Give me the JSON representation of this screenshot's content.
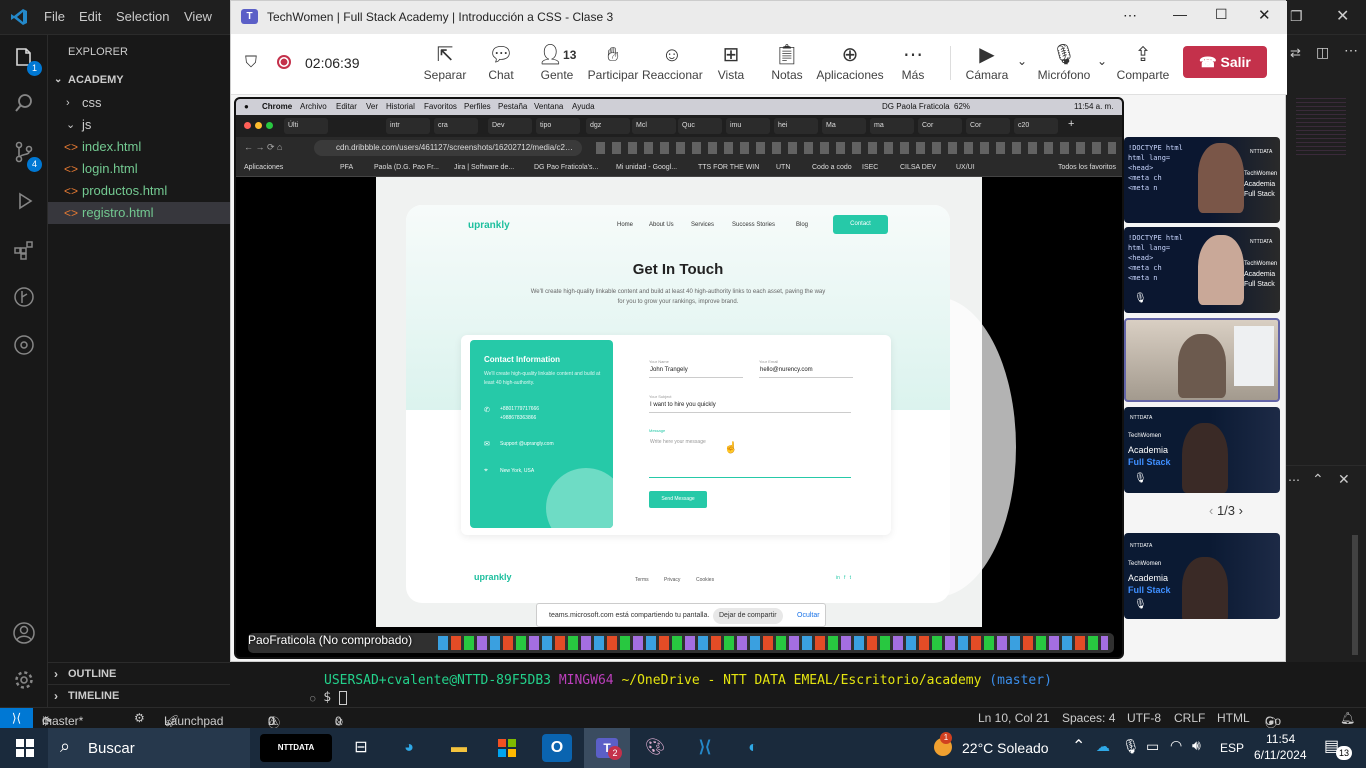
{
  "vscode": {
    "menu": [
      "File",
      "Edit",
      "Selection",
      "View"
    ],
    "explorer_title": "EXPLORER",
    "project": "ACADEMY",
    "tree": [
      {
        "name": "css",
        "type": "folder",
        "open": false
      },
      {
        "name": "js",
        "type": "folder",
        "open": true
      },
      {
        "name": "index.html",
        "type": "file"
      },
      {
        "name": "login.html",
        "type": "file"
      },
      {
        "name": "productos.html",
        "type": "file"
      },
      {
        "name": "registro.html",
        "type": "file",
        "selected": true
      }
    ],
    "outline": "OUTLINE",
    "timeline": "TIMELINE",
    "badges": {
      "explorer": "1",
      "scm": "4"
    },
    "terminal": {
      "user": "USERSAD+cvalente@NTTD-89F5DB3",
      "shell": "MINGW64",
      "path": "~/OneDrive - NTT DATA EMEAL/Escritorio/academy",
      "branch": "(master)",
      "prompt": "$"
    },
    "status": {
      "branch": "master*",
      "launchpad": "Launchpad",
      "errors": "0",
      "warnings": "0",
      "ports": "0",
      "position": "Ln 10, Col 21",
      "spaces": "Spaces: 4",
      "encoding": "UTF-8",
      "eol": "CRLF",
      "language": "HTML",
      "golive": "Go Live"
    }
  },
  "teams": {
    "title": "TechWomen | Full Stack Academy | Introducción a CSS - Clase 3",
    "timer": "02:06:39",
    "controls": [
      {
        "label": "Separar",
        "icon": "popout-icon"
      },
      {
        "label": "Chat",
        "icon": "chat-icon"
      },
      {
        "label": "Gente",
        "icon": "people-icon",
        "count": "13"
      },
      {
        "label": "Participar",
        "icon": "raise-hand-icon"
      },
      {
        "label": "Reaccionar",
        "icon": "smile-icon"
      },
      {
        "label": "Vista",
        "icon": "grid-icon"
      },
      {
        "label": "Notas",
        "icon": "notes-icon"
      },
      {
        "label": "Aplicaciones",
        "icon": "plus-icon"
      },
      {
        "label": "Más",
        "icon": "more-icon"
      }
    ],
    "camera": "Cámara",
    "mic": "Micrófono",
    "share": "Comparte",
    "leave": "Salir",
    "presenter": "PaoFraticola (No comprobado)",
    "pagination": "1/3",
    "tile_texts": {
      "t1": [
        "TechWomen",
        "Academia",
        "Full Stack"
      ],
      "brand": "NTTDATA"
    }
  },
  "shared": {
    "mac_menu": [
      "Chrome",
      "Archivo",
      "Editar",
      "Ver",
      "Historial",
      "Favoritos",
      "Perfiles",
      "Pestaña",
      "Ventana",
      "Ayuda"
    ],
    "mac_status": [
      "DG Paola Fraticola",
      "62%",
      "11:54 a. m."
    ],
    "url": "cdn.dribbble.com/users/461127/screenshots/16202712/media/c2…",
    "tabs": [
      "Últi",
      "",
      "intr",
      "cra",
      "Dev",
      "tipo",
      "dgz",
      "Mcl",
      "Quc",
      "imu",
      "hei",
      "Ma",
      "ma",
      "Cor",
      "Cor",
      "c20"
    ],
    "bookmarks": [
      "Aplicaciones",
      "PFA",
      "Paola (D.G. Pao Fr...",
      "Jira | Software de...",
      "DG Pao Fraticola's...",
      "Mi unidad - Googl...",
      "TTS FOR THE WIN",
      "UTN",
      "Codo a codo",
      "ISEC",
      "CILSA DEV",
      "UX/UI",
      "Todos los favoritos"
    ],
    "sharing_bar": {
      "text": "teams.microsoft.com está compartiendo tu pantalla.",
      "stop": "Dejar de compartir",
      "hide": "Ocultar"
    },
    "site": {
      "logo": "uprankly",
      "nav": [
        "Home",
        "About Us",
        "Services",
        "Success Stories",
        "Blog"
      ],
      "cta": "Contact",
      "heading": "Get In Touch",
      "subtext": "We'll create high-quality linkable content and build at least 40 high-authority links to each asset, paving the way for you to grow your rankings, improve brand.",
      "info_title": "Contact Information",
      "info_text": "We'll create high-quality linkable content and build at least 40 high-authority.",
      "phone1": "+8801779717666",
      "phone2": "+988678363866",
      "email": "Support @uprangly.com",
      "location": "New York, USA",
      "fields": {
        "name_label": "Your Name",
        "name_value": "John Trangely",
        "email_label": "Your Email",
        "email_value": "hello@nurency.com",
        "subject_label": "Your Subject",
        "subject_value": "I want to hire you quickly",
        "message_label": "Message",
        "message_placeholder": "Write here your message"
      },
      "send": "Send Message",
      "footer_links": [
        "Terms",
        "Privacy",
        "Cookies"
      ]
    }
  },
  "taskbar": {
    "search": "Buscar",
    "weather": "22°C  Soleado",
    "weather_badge": "1",
    "teams_badge": "2",
    "lang": "ESP",
    "time": "11:54",
    "date": "6/11/2024",
    "notif": "13",
    "ntt_label": "NTTDATA"
  },
  "colors": {
    "accent": "#0078d4",
    "teal": "#26c9a8",
    "leave": "#c4314b",
    "term_green": "#23d18b",
    "term_purple": "#bc3fbc",
    "term_yellow": "#e5e510",
    "term_blue": "#3b8eea"
  }
}
